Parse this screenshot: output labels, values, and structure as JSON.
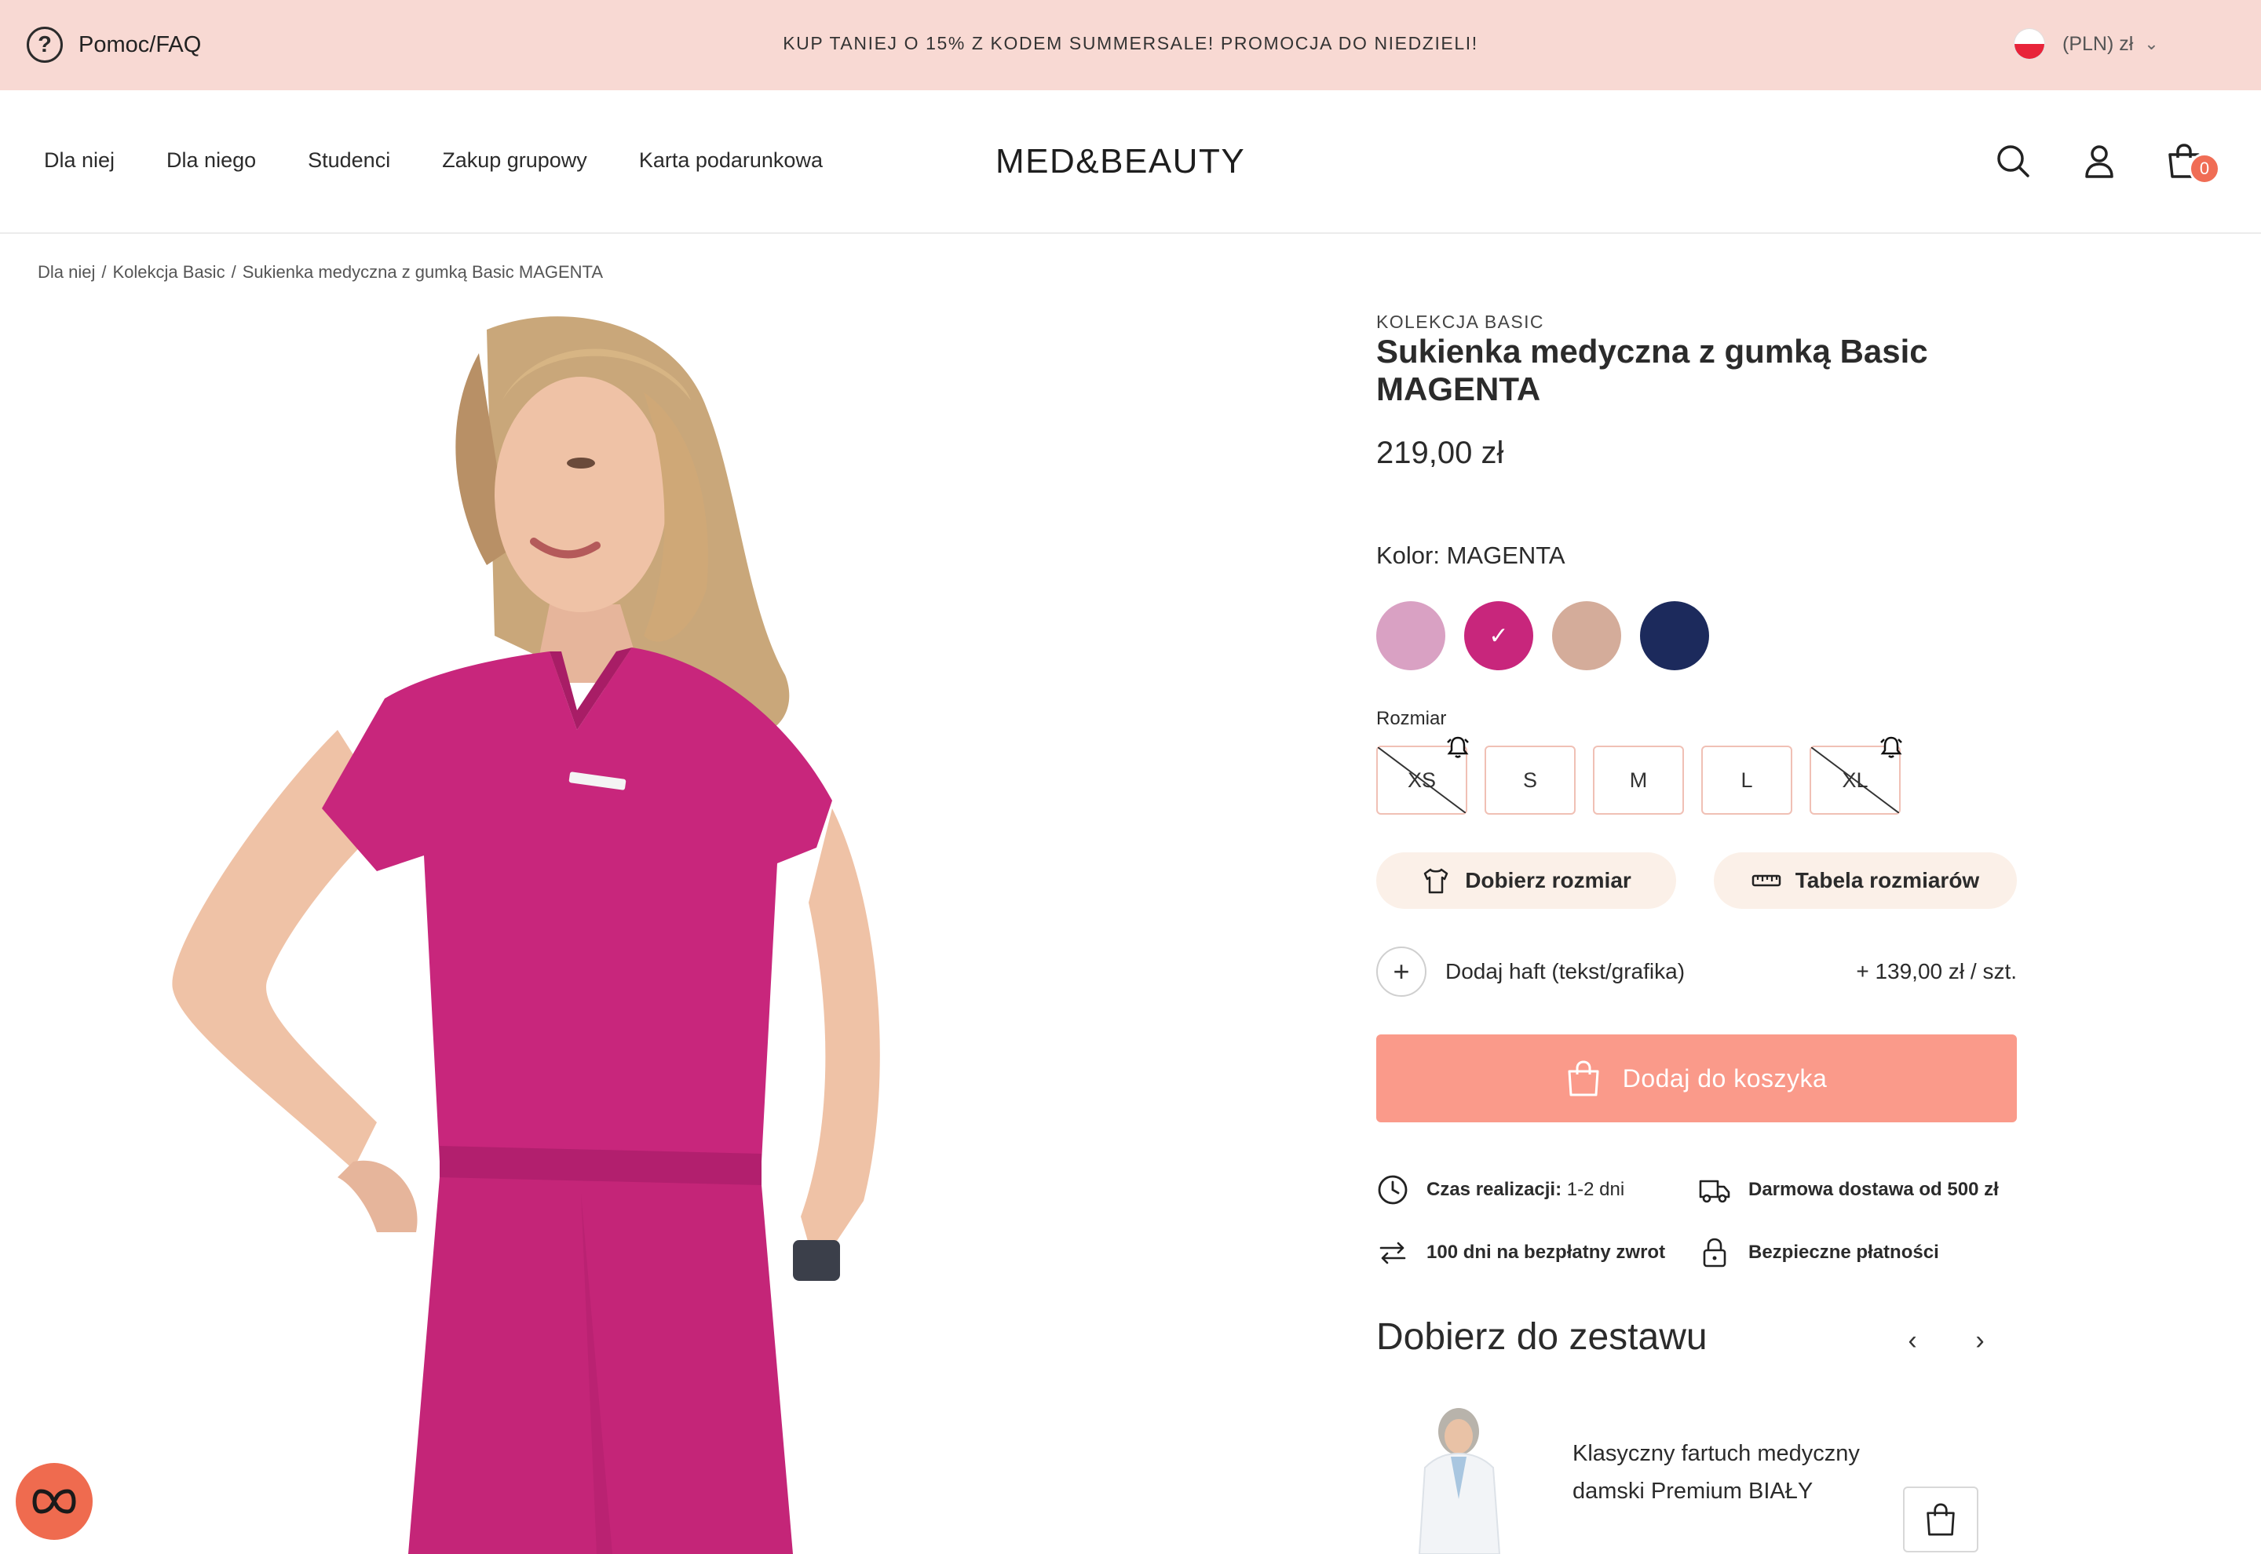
{
  "promo_bar": {
    "help_label": "Pomoc/FAQ",
    "message": "KUP TANIEJ O 15% Z KODEM SUMMERSALE! PROMOCJA DO NIEDZIELI!",
    "currency": "(PLN) zł",
    "flag_icon": "poland-flag-icon"
  },
  "header": {
    "nav": [
      "Dla niej",
      "Dla niego",
      "Studenci",
      "Zakup grupowy",
      "Karta podarunkowa"
    ],
    "logo": "MED&BEAUTY",
    "cart_count": "0",
    "icons": [
      "search-icon",
      "user-icon",
      "bag-icon"
    ]
  },
  "breadcrumb": {
    "items": [
      "Dla niej",
      "Kolekcja Basic",
      "Sukienka medyczna z gumką Basic MAGENTA"
    ],
    "separator": "/"
  },
  "product": {
    "collection": "KOLEKCJA BASIC",
    "title": "Sukienka medyczna z gumką Basic MAGENTA",
    "price": "219,00 zł",
    "color_label": "Kolor: MAGENTA",
    "swatches": [
      {
        "name": "lilac",
        "hex": "#d9a1c3",
        "selected": false
      },
      {
        "name": "magenta",
        "hex": "#c8267c",
        "selected": true
      },
      {
        "name": "beige",
        "hex": "#d4ac9a",
        "selected": false
      },
      {
        "name": "navy",
        "hex": "#1c2a5c",
        "selected": false
      }
    ],
    "size_label": "Rozmiar",
    "sizes": [
      {
        "label": "XS",
        "available": false
      },
      {
        "label": "S",
        "available": true
      },
      {
        "label": "M",
        "available": true
      },
      {
        "label": "L",
        "available": true
      },
      {
        "label": "XL",
        "available": false
      }
    ],
    "fit_button": "Dobierz rozmiar",
    "size_table_button": "Tabela rozmiarów",
    "embroidery_label": "Dodaj haft (tekst/grafika)",
    "embroidery_price": "+ 139,00 zł / szt.",
    "add_to_cart": "Dodaj do koszyka",
    "features": {
      "lead_time_label": "Czas realizacji:",
      "lead_time_value": "1-2 dni",
      "shipping": "Darmowa dostawa od 500 zł",
      "returns": "100 dni na bezpłatny zwrot",
      "payments": "Bezpieczne płatności"
    }
  },
  "set_section": {
    "title": "Dobierz do zestawu",
    "item_name": "Klasyczny fartuch medyczny damski Premium BIAŁY"
  },
  "colors": {
    "promo_bg": "#f8d9d3",
    "accent": "#fa9a8a",
    "badge": "#f06d55",
    "dress": "#c8267c"
  }
}
